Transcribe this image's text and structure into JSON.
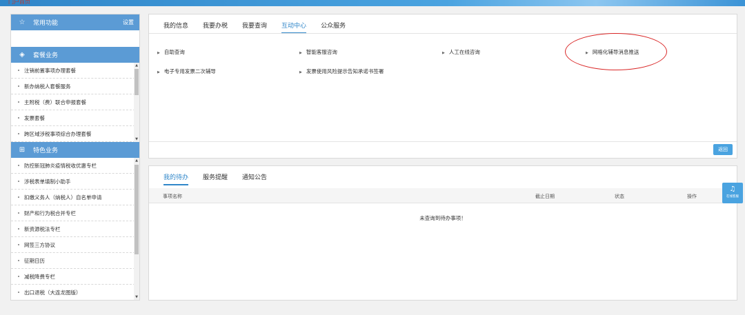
{
  "header": {
    "brand": "门户首页"
  },
  "sidebar": {
    "common": {
      "title": "常用功能",
      "setting": "设置"
    },
    "package": {
      "title": "套餐业务",
      "items": [
        "注销前置事项办理套餐",
        "新办纳税人套餐服务",
        "主附税（费）联合申报套餐",
        "发票套餐",
        "跨区域涉税事项综合办理套餐"
      ]
    },
    "special": {
      "title": "特色业务",
      "items": [
        "防控新冠肺炎疫情税收优惠专栏",
        "涉税表单填制小助手",
        "扣缴义务人（纳税人）自名单申请",
        "财产和行为税合并专栏",
        "新资源税法专栏",
        "网签三方协议",
        "征期日历",
        "减税降费专栏",
        "出口退税（大连龙图版）"
      ]
    }
  },
  "top_panel": {
    "tabs": [
      "我的信息",
      "我要办税",
      "我要查询",
      "互动中心",
      "公众服务"
    ],
    "active_tab": 3,
    "links": [
      "自助查询",
      "智能客服咨询",
      "人工在线咨询",
      "网格化辅导消息推送",
      "电子专用发票二次辅导",
      "发票使用风险提示告知承诺书签署"
    ],
    "return_label": "返回"
  },
  "bottom_panel": {
    "tabs": [
      "我的待办",
      "服务提醒",
      "通知公告"
    ],
    "active_tab": 0,
    "columns": {
      "name": "事项名称",
      "deadline": "截止日期",
      "status": "状态",
      "action": "操作"
    },
    "empty_text": "未查询到待办事项！"
  },
  "float_service": {
    "label": "在线客服"
  }
}
